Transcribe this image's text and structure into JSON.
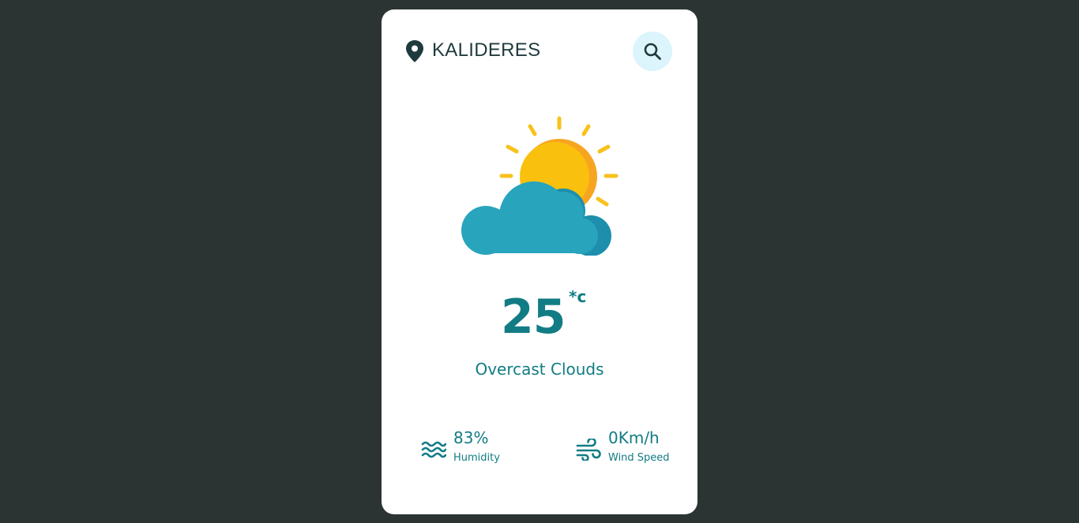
{
  "location": {
    "city": "KALIDERES",
    "pin_icon": "map-pin-icon"
  },
  "search": {
    "icon": "search-icon",
    "color_bg": "#dcf4fb"
  },
  "weather": {
    "icon": "partly-cloudy-sun-icon",
    "temperature": "25",
    "unit": "*c",
    "description": "Overcast Clouds"
  },
  "stats": {
    "humidity": {
      "value": "83%",
      "label": "Humidity",
      "icon": "water-waves-icon"
    },
    "wind": {
      "value": "0Km/h",
      "label": "Wind Speed",
      "icon": "wind-icon"
    }
  },
  "colors": {
    "background": "#2c3333",
    "card": "#ffffff",
    "accent": "#127c84",
    "text_dark": "#1f3a3c"
  }
}
